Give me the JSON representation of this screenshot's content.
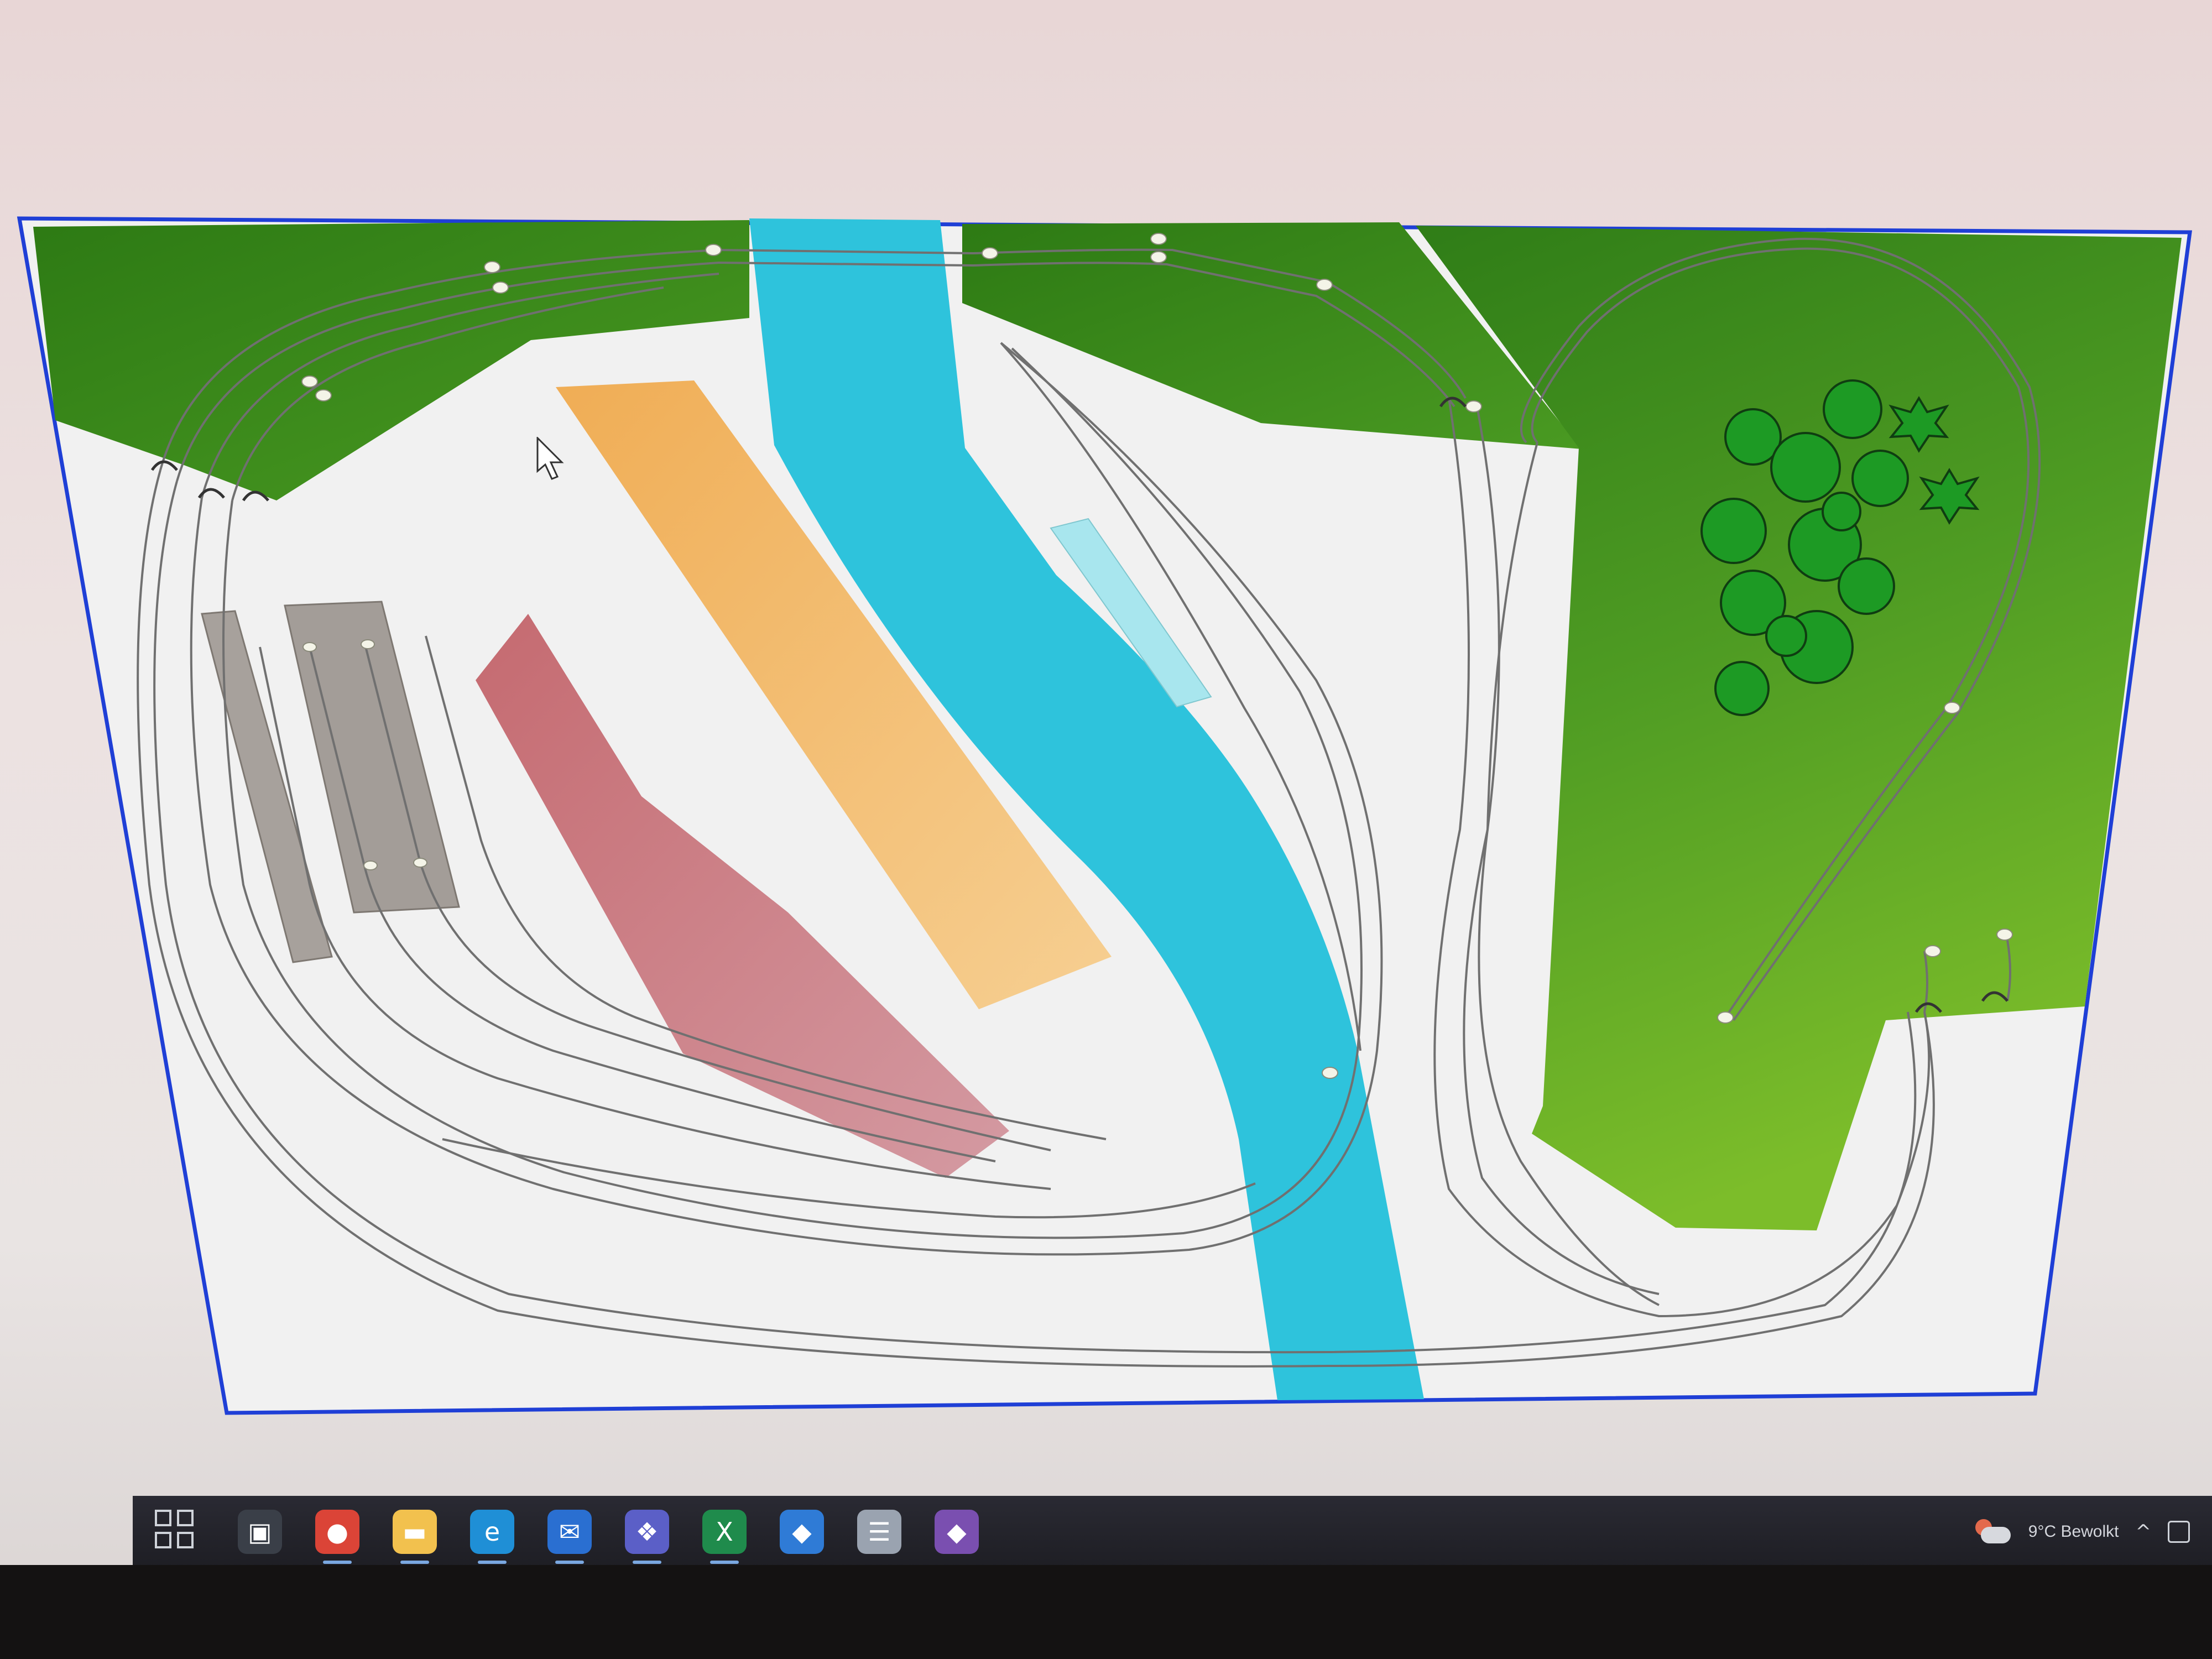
{
  "canvas": {
    "border_color": "#1f3fd6",
    "background_color": "#f1f1f1",
    "track_color": "#6d6d6d"
  },
  "regions": [
    {
      "name": "top-left-terrain",
      "color": "#3f8f1d"
    },
    {
      "name": "top-middle-terrain",
      "color": "#3f8f1d"
    },
    {
      "name": "right-terrain",
      "color": "#4f9c23"
    },
    {
      "name": "river",
      "color": "#2ec3dc"
    },
    {
      "name": "orange-building",
      "color": "#f0b767"
    },
    {
      "name": "red-building",
      "color": "#c97a7f"
    },
    {
      "name": "platform-1",
      "color": "#a7a19c"
    },
    {
      "name": "platform-2",
      "color": "#a39d98"
    },
    {
      "name": "light-blue-platform",
      "color": "#a8e6ee"
    }
  ],
  "trees": {
    "color": "#1d9a24",
    "outline": "#0f3d11",
    "count": 12,
    "conifers": 2
  },
  "taskbar": {
    "apps": [
      {
        "name": "task-view",
        "icon": "task-view-icon",
        "color": "#3a3f48"
      },
      {
        "name": "chrome",
        "icon": "chrome-icon",
        "color": "#db4437"
      },
      {
        "name": "file-explorer",
        "icon": "folder-icon",
        "color": "#f2c14e"
      },
      {
        "name": "edge",
        "icon": "edge-icon",
        "color": "#1f8fd6"
      },
      {
        "name": "outlook",
        "icon": "mail-icon",
        "color": "#2a6fd1"
      },
      {
        "name": "teams",
        "icon": "chat-icon",
        "color": "#5b5fc7"
      },
      {
        "name": "excel",
        "icon": "spreadsheet-icon",
        "color": "#1f8b4c"
      },
      {
        "name": "app-blue",
        "icon": "app-icon",
        "color": "#2f7bd6"
      },
      {
        "name": "notepad",
        "icon": "document-icon",
        "color": "#9aa3b0"
      },
      {
        "name": "app-purple",
        "icon": "app-icon",
        "color": "#7a4fb0"
      }
    ],
    "weather_text": "9°C  Bewolkt"
  }
}
